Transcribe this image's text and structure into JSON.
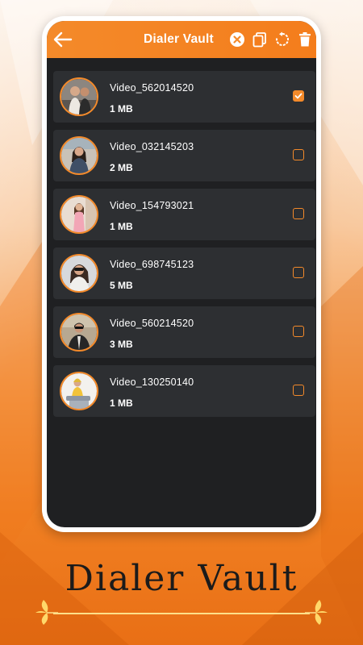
{
  "toolbar": {
    "back_icon": "back-arrow-icon",
    "title": "Dialer Vault",
    "actions": [
      "close-icon",
      "copy-icon",
      "restore-icon",
      "delete-icon"
    ]
  },
  "videos": [
    {
      "name": "Video_562014520",
      "size": "1 MB",
      "checked": true
    },
    {
      "name": "Video_032145203",
      "size": "2 MB",
      "checked": false
    },
    {
      "name": "Video_154793021",
      "size": "1 MB",
      "checked": false
    },
    {
      "name": "Video_698745123",
      "size": "5 MB",
      "checked": false
    },
    {
      "name": "Video_560214520",
      "size": "3 MB",
      "checked": false
    },
    {
      "name": "Video_130250140",
      "size": "1 MB",
      "checked": false
    }
  ],
  "banner": {
    "title": "Dialer Vault"
  },
  "colors": {
    "accent": "#f48a2a",
    "screen_bg": "#1f2022",
    "row_bg": "#2d2f32"
  }
}
